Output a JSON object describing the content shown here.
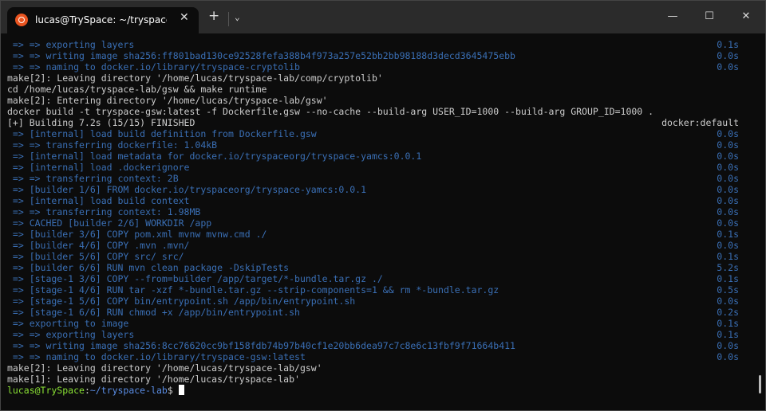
{
  "window": {
    "tab_title": "lucas@TrySpace: ~/tryspace-lab",
    "tab_icon": "ubuntu-icon",
    "new_tab": "+",
    "dropdown": "⌄",
    "minimize": "—",
    "maximize": "☐",
    "close": "✕",
    "tab_close": "✕"
  },
  "colors": {
    "output": "#cccccc",
    "docker": "#3a6fb5",
    "prompt_user": "#8ae234",
    "prompt_path": "#5b8ee6"
  },
  "lines": [
    {
      "text": " => => exporting layers",
      "time": "0.1s",
      "c": "b"
    },
    {
      "text": " => => writing image sha256:ff801bad130ce92528fefa388b4f973a257e52bb2bb98188d3decd3645475ebb",
      "time": "0.0s",
      "c": "b"
    },
    {
      "text": " => => naming to docker.io/library/tryspace-cryptolib",
      "time": "0.0s",
      "c": "b"
    },
    {
      "text": "make[2]: Leaving directory '/home/lucas/tryspace-lab/comp/cryptolib'",
      "c": "w"
    },
    {
      "text": "cd /home/lucas/tryspace-lab/gsw && make runtime",
      "c": "w"
    },
    {
      "text": "make[2]: Entering directory '/home/lucas/tryspace-lab/gsw'",
      "c": "w"
    },
    {
      "text": "docker build -t tryspace-gsw:latest -f Dockerfile.gsw --no-cache --build-arg USER_ID=1000 --build-arg GROUP_ID=1000 .",
      "c": "w"
    },
    {
      "text": "[+] Building 7.2s (15/15) FINISHED",
      "time": "docker:default",
      "c": "w"
    },
    {
      "text": " => [internal] load build definition from Dockerfile.gsw",
      "time": "0.0s",
      "c": "b"
    },
    {
      "text": " => => transferring dockerfile: 1.04kB",
      "time": "0.0s",
      "c": "b"
    },
    {
      "text": " => [internal] load metadata for docker.io/tryspaceorg/tryspace-yamcs:0.0.1",
      "time": "0.0s",
      "c": "b"
    },
    {
      "text": " => [internal] load .dockerignore",
      "time": "0.0s",
      "c": "b"
    },
    {
      "text": " => => transferring context: 2B",
      "time": "0.0s",
      "c": "b"
    },
    {
      "text": " => [builder 1/6] FROM docker.io/tryspaceorg/tryspace-yamcs:0.0.1",
      "time": "0.0s",
      "c": "b"
    },
    {
      "text": " => [internal] load build context",
      "time": "0.0s",
      "c": "b"
    },
    {
      "text": " => => transferring context: 1.98MB",
      "time": "0.0s",
      "c": "b"
    },
    {
      "text": " => CACHED [builder 2/6] WORKDIR /app",
      "time": "0.0s",
      "c": "b"
    },
    {
      "text": " => [builder 3/6] COPY pom.xml mvnw mvnw.cmd ./",
      "time": "0.1s",
      "c": "b"
    },
    {
      "text": " => [builder 4/6] COPY .mvn .mvn/",
      "time": "0.0s",
      "c": "b"
    },
    {
      "text": " => [builder 5/6] COPY src/ src/",
      "time": "0.1s",
      "c": "b"
    },
    {
      "text": " => [builder 6/6] RUN mvn clean package -DskipTests",
      "time": "5.2s",
      "c": "b"
    },
    {
      "text": " => [stage-1 3/6] COPY --from=builder /app/target/*-bundle.tar.gz ./",
      "time": "0.1s",
      "c": "b"
    },
    {
      "text": " => [stage-1 4/6] RUN tar -xzf *-bundle.tar.gz --strip-components=1 && rm *-bundle.tar.gz",
      "time": "0.5s",
      "c": "b"
    },
    {
      "text": " => [stage-1 5/6] COPY bin/entrypoint.sh /app/bin/entrypoint.sh",
      "time": "0.0s",
      "c": "b"
    },
    {
      "text": " => [stage-1 6/6] RUN chmod +x /app/bin/entrypoint.sh",
      "time": "0.2s",
      "c": "b"
    },
    {
      "text": " => exporting to image",
      "time": "0.1s",
      "c": "b"
    },
    {
      "text": " => => exporting layers",
      "time": "0.1s",
      "c": "b"
    },
    {
      "text": " => => writing image sha256:8cc76620cc9bf158fdb74b97b40cf1e20bb6dea97c7c8e6c13fbf9f71664b411",
      "time": "0.0s",
      "c": "b"
    },
    {
      "text": " => => naming to docker.io/library/tryspace-gsw:latest",
      "time": "0.0s",
      "c": "b"
    },
    {
      "text": "make[2]: Leaving directory '/home/lucas/tryspace-lab/gsw'",
      "c": "w"
    },
    {
      "text": "make[1]: Leaving directory '/home/lucas/tryspace-lab'",
      "c": "w"
    }
  ],
  "prompt": {
    "user": "lucas@TrySpace",
    "colon": ":",
    "path": "~/tryspace-lab",
    "symbol": "$ "
  }
}
